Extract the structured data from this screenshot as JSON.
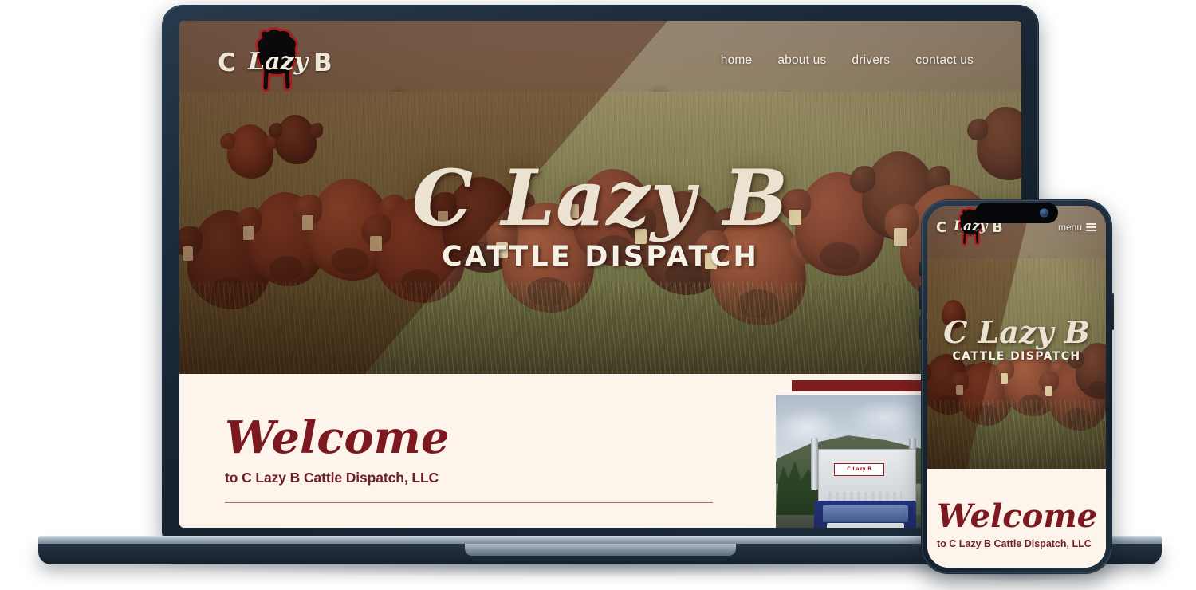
{
  "brand": {
    "name": "C Lazy B",
    "letter_c": "C",
    "letter_b": "B",
    "script_word": "Lazy",
    "bull_icon": "bull-silhouette-icon"
  },
  "nav": {
    "items": [
      {
        "label": "home"
      },
      {
        "label": "about us"
      },
      {
        "label": "drivers"
      },
      {
        "label": "contact us"
      }
    ]
  },
  "hero": {
    "title": "C Lazy B",
    "subtitle": "CATTLE DISPATCH"
  },
  "welcome": {
    "title": "Welcome",
    "subtitle": "to C Lazy B Cattle Dispatch, LLC"
  },
  "truck": {
    "door_logo": "C Lazy B",
    "alt": "semi-truck-photo"
  },
  "mobile": {
    "menu_label": "menu",
    "menu_icon": "hamburger-icon",
    "hero": {
      "title": "C Lazy B",
      "subtitle": "CATTLE DISPATCH"
    },
    "welcome": {
      "title": "Welcome",
      "subtitle": "to C Lazy B Cattle Dispatch, LLC"
    }
  },
  "colors": {
    "cream": "#fdf5ec",
    "maroon": "#7b1820",
    "maroon_text": "#6d2026",
    "rule": "#b06a63",
    "bar_red": "#7d1d1d",
    "device": "#1b2a3a",
    "logo_cream": "#efe6d8"
  }
}
